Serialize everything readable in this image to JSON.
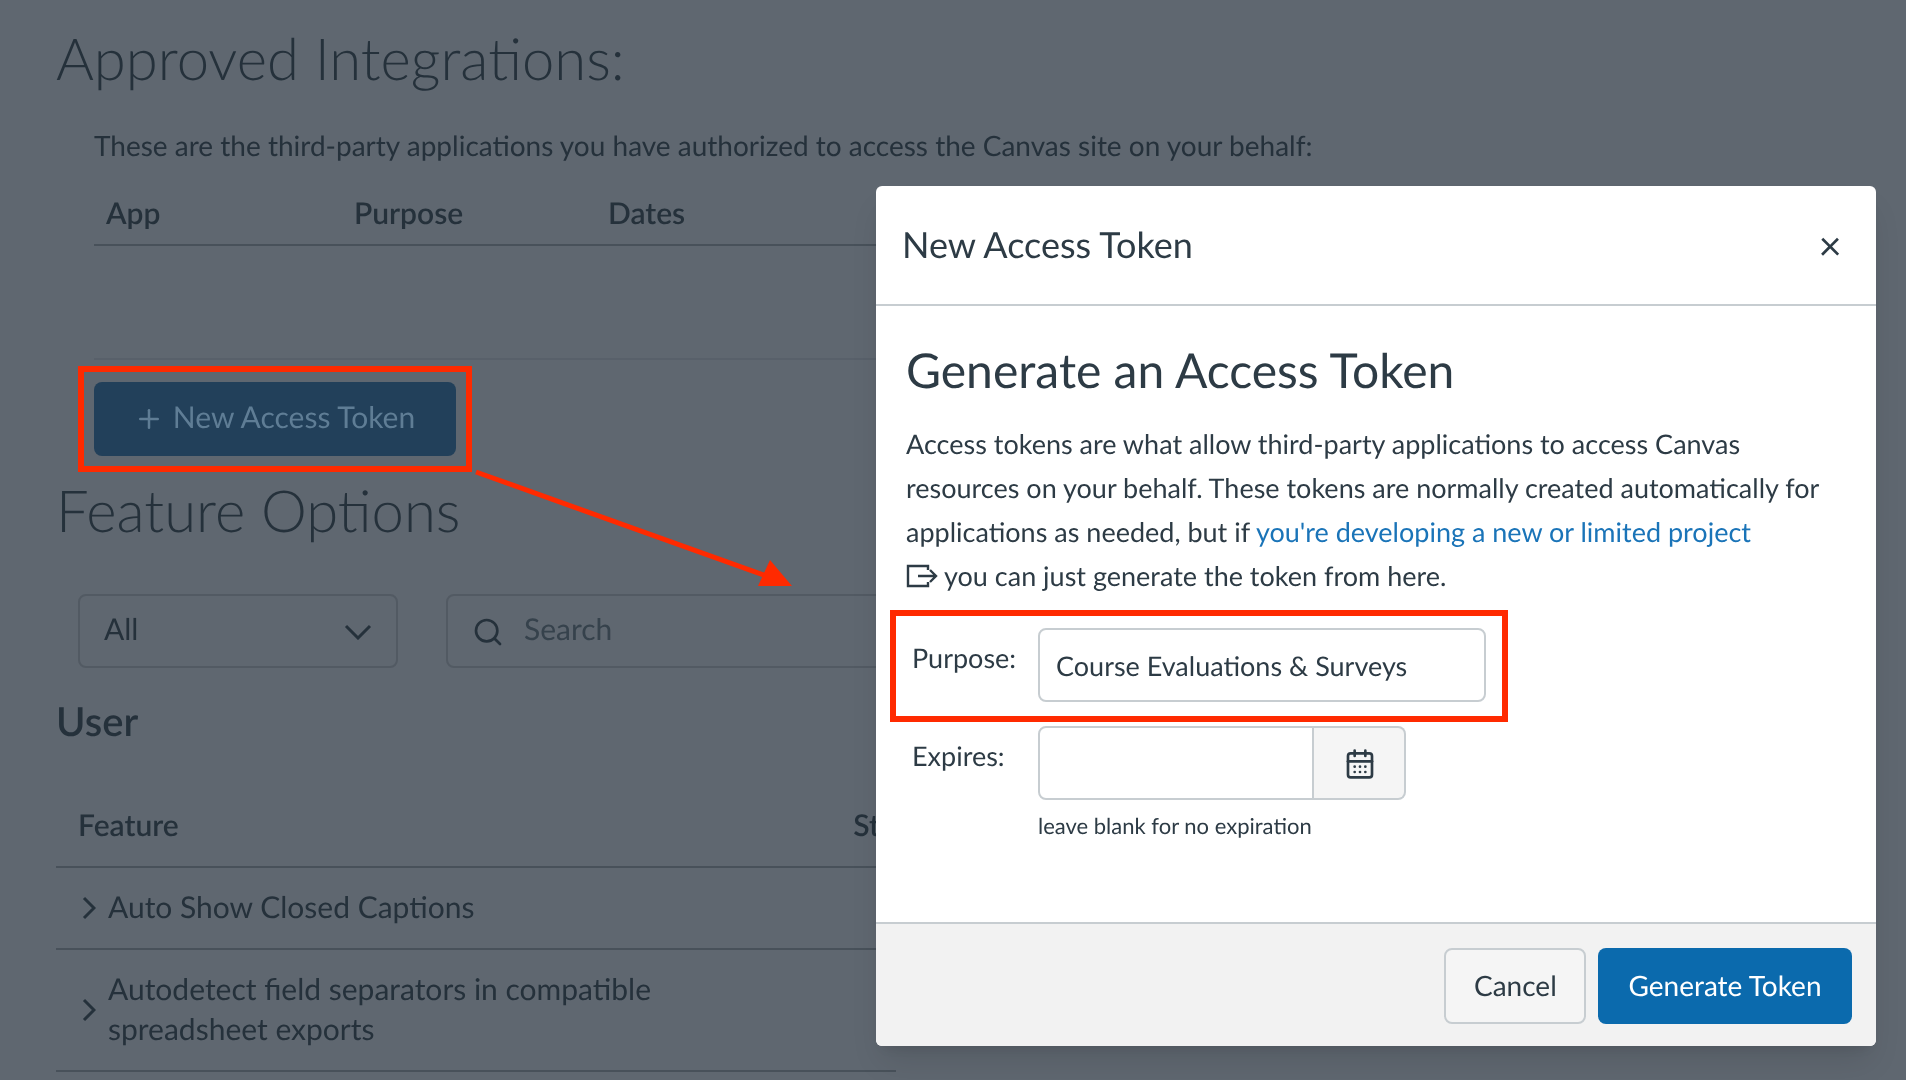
{
  "page": {
    "title": "Approved Integrations:",
    "intro": "These are the third-party applications you have authorized to access the Canvas site on your behalf:",
    "table_columns": [
      "App",
      "Purpose",
      "Dates"
    ],
    "new_token_button": {
      "label": "New Access Token",
      "highlighted": true
    },
    "feature_title": "Feature Options",
    "filter": {
      "value": "All"
    },
    "search": {
      "placeholder": "Search"
    },
    "section": "User",
    "feature_columns": [
      "Feature",
      "St"
    ],
    "features": [
      {
        "label": "Auto Show Closed Captions",
        "expanded": false
      },
      {
        "label": "Autodetect field separators in compatible spreadsheet exports",
        "expanded": false
      }
    ]
  },
  "dialog": {
    "title": "New Access Token",
    "close": "×",
    "heading": "Generate an Access Token",
    "description_before": "Access tokens are what allow third-party applications to access Canvas resources on your behalf. These tokens are normally created automatically for applications as needed, but if ",
    "description_link": "you're developing a new or limited project",
    "description_after": "you can just generate the token from here.",
    "purpose": {
      "label": "Purpose:",
      "value": "Course Evaluations & Surveys",
      "highlighted": true
    },
    "expires": {
      "label": "Expires:",
      "hint": "leave blank for no expiration"
    },
    "buttons": [
      {
        "label": "Cancel",
        "kind": "secondary"
      },
      {
        "label": "Generate Token",
        "kind": "primary"
      }
    ]
  }
}
